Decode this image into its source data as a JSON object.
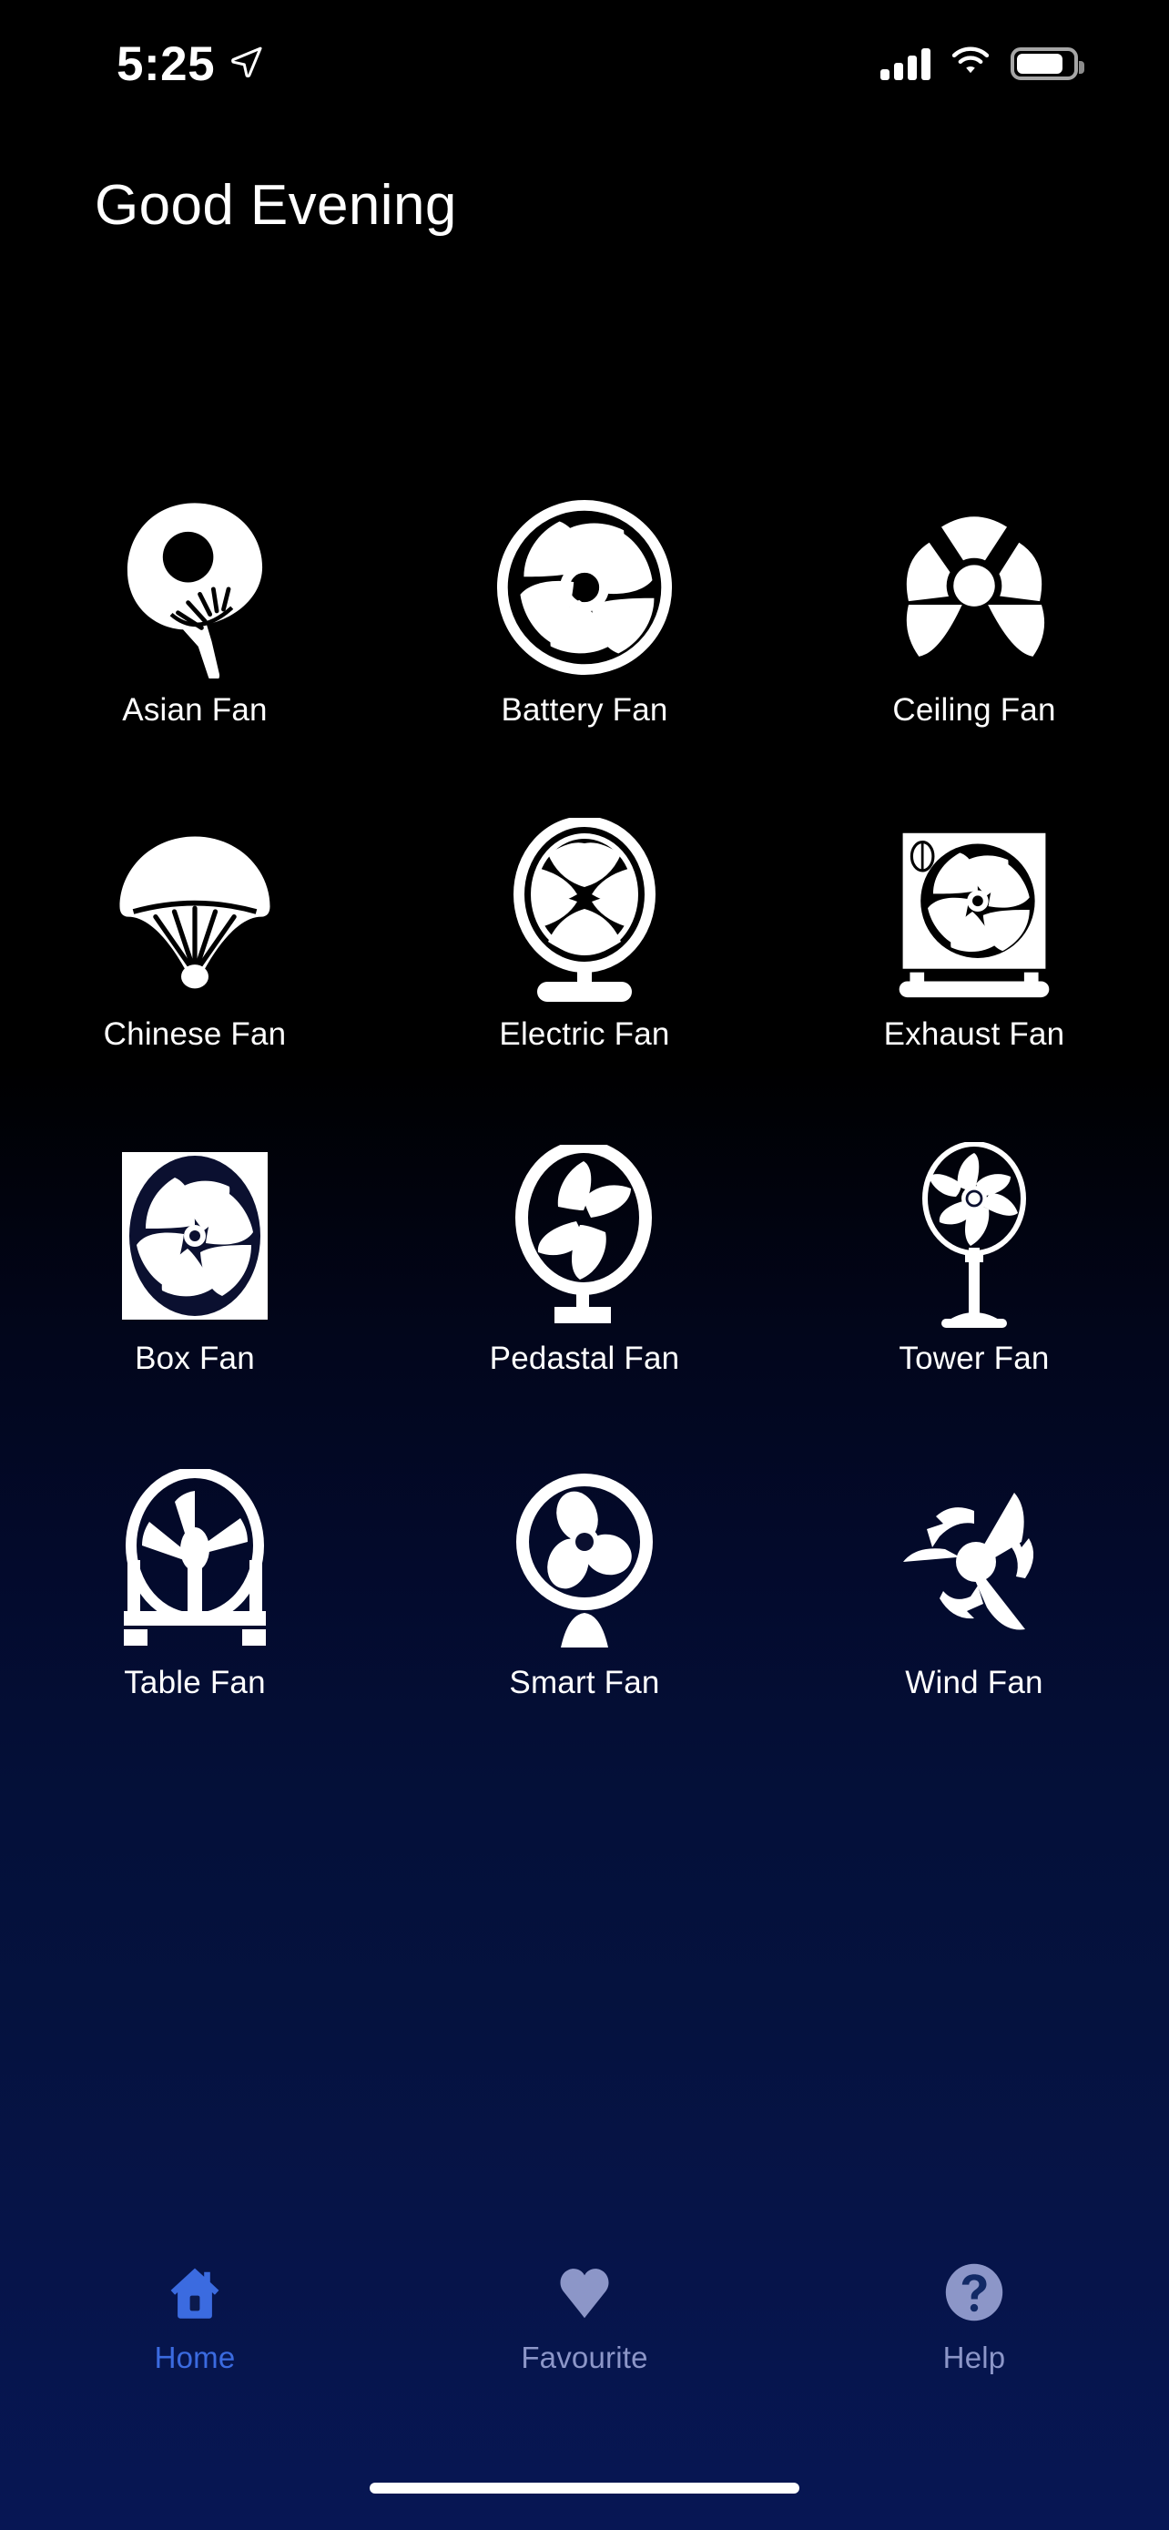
{
  "status_bar": {
    "time": "5:25",
    "location_icon": "location-arrow-icon",
    "cellular_icon": "cellular-signal-icon",
    "wifi_icon": "wifi-icon",
    "battery_icon": "battery-icon",
    "battery_level_percent": 80
  },
  "header": {
    "greeting": "Good Evening"
  },
  "colors": {
    "background_top": "#000000",
    "background_bottom": "#071654",
    "icon": "#ffffff",
    "label": "#ffffff",
    "tab_active": "#3B6BE0",
    "tab_inactive": "#8C96C8"
  },
  "grid": {
    "items": [
      {
        "label": "Asian Fan",
        "icon": "asian-fan-icon"
      },
      {
        "label": "Battery Fan",
        "icon": "battery-fan-icon"
      },
      {
        "label": "Ceiling Fan",
        "icon": "ceiling-fan-icon"
      },
      {
        "label": "Chinese Fan",
        "icon": "chinese-fan-icon"
      },
      {
        "label": "Electric Fan",
        "icon": "electric-fan-icon"
      },
      {
        "label": "Exhaust Fan",
        "icon": "exhaust-fan-icon"
      },
      {
        "label": "Box Fan",
        "icon": "box-fan-icon"
      },
      {
        "label": "Pedastal Fan",
        "icon": "pedestal-fan-icon"
      },
      {
        "label": "Tower Fan",
        "icon": "tower-fan-icon"
      },
      {
        "label": "Table Fan",
        "icon": "table-fan-icon"
      },
      {
        "label": "Smart Fan",
        "icon": "smart-fan-icon"
      },
      {
        "label": "Wind Fan",
        "icon": "wind-fan-icon"
      }
    ]
  },
  "tab_bar": {
    "tabs": [
      {
        "label": "Home",
        "icon": "home-icon",
        "active": true
      },
      {
        "label": "Favourite",
        "icon": "heart-icon",
        "active": false
      },
      {
        "label": "Help",
        "icon": "question-mark-icon",
        "active": false
      }
    ]
  }
}
